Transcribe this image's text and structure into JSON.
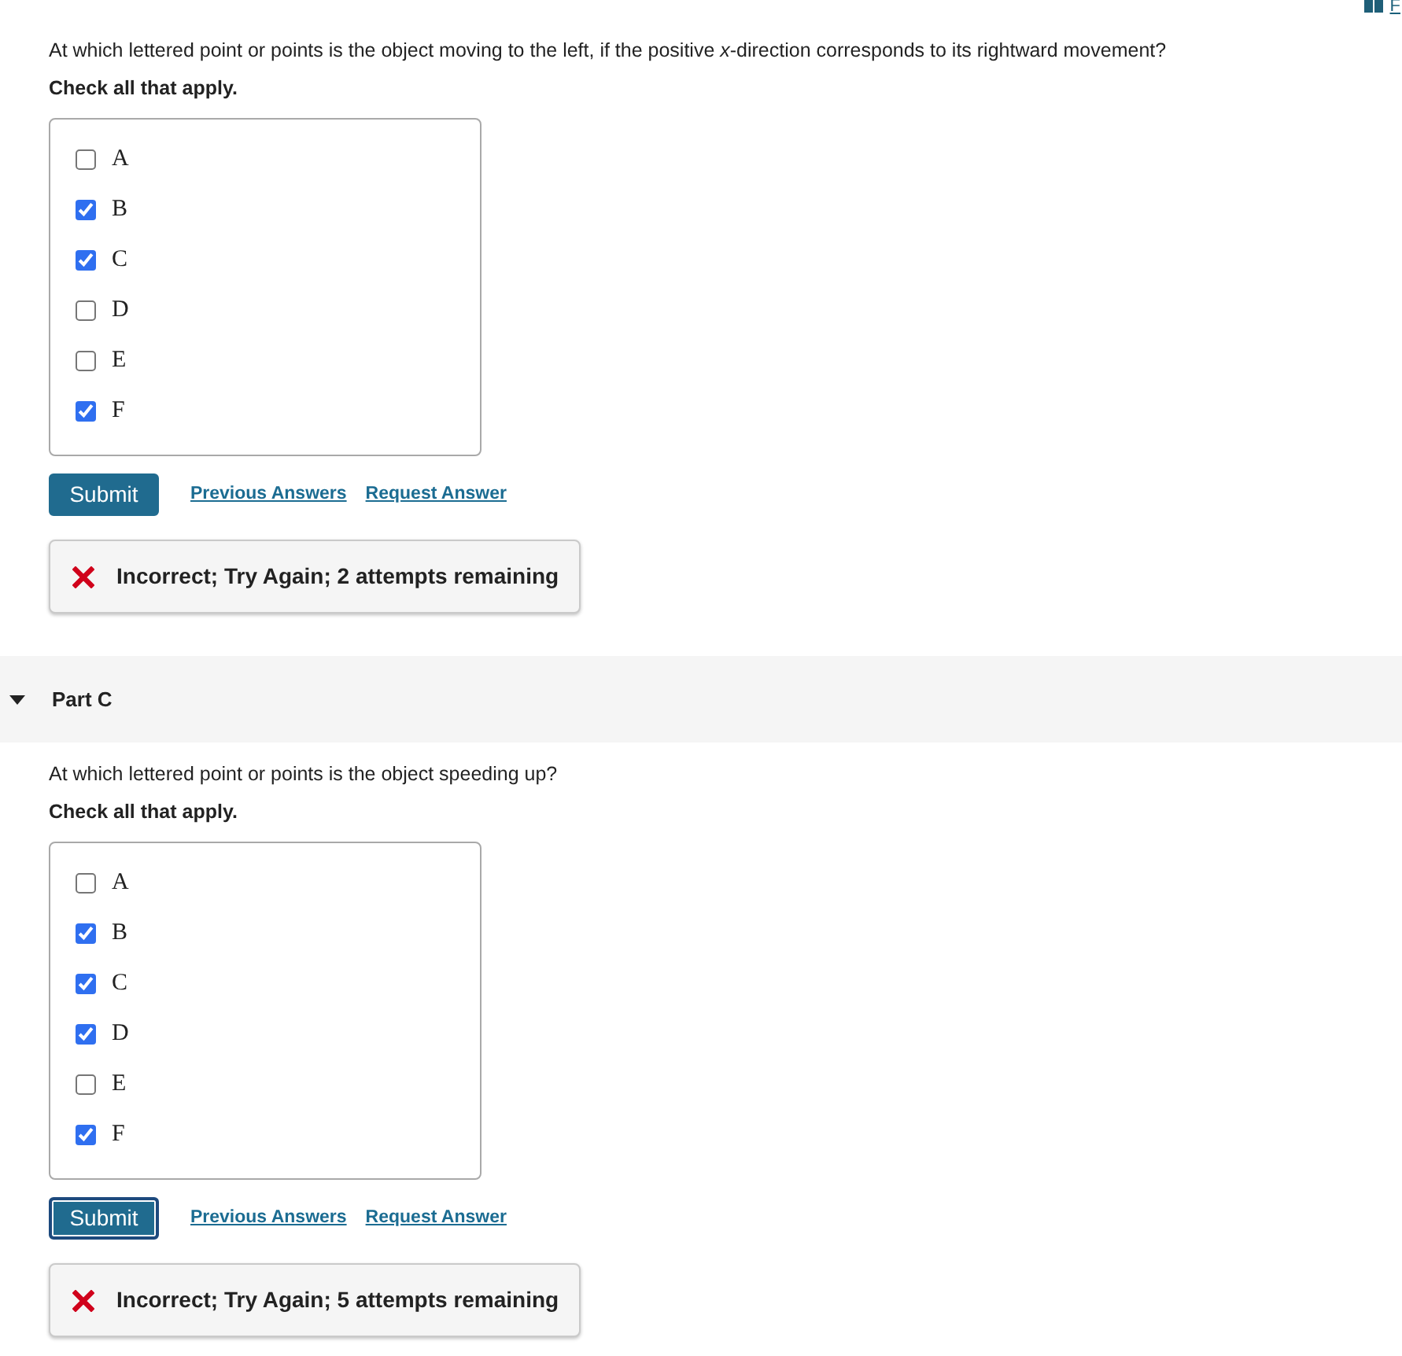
{
  "top_link": {
    "label": "F"
  },
  "questions": [
    {
      "prompt": "At which lettered point or points is the object moving to the left, if the positive *x*-direction corresponds to its rightward movement?",
      "instruction": "Check all that apply.",
      "options": [
        {
          "label": "A",
          "checked": false
        },
        {
          "label": "B",
          "checked": true
        },
        {
          "label": "C",
          "checked": true
        },
        {
          "label": "D",
          "checked": false
        },
        {
          "label": "E",
          "checked": false
        },
        {
          "label": "F",
          "checked": true
        }
      ],
      "submit": {
        "label": "Submit",
        "focused": false
      },
      "links": [
        "Previous Answers",
        "Request Answer"
      ],
      "feedback": {
        "kind": "incorrect",
        "text": "Incorrect; Try Again; 2 attempts remaining"
      }
    },
    {
      "part_header": {
        "title": "Part C",
        "expanded": true
      },
      "prompt": "At which lettered point or points is the object speeding up?",
      "instruction": "Check all that apply.",
      "options": [
        {
          "label": "A",
          "checked": false
        },
        {
          "label": "B",
          "checked": true
        },
        {
          "label": "C",
          "checked": true
        },
        {
          "label": "D",
          "checked": true
        },
        {
          "label": "E",
          "checked": false
        },
        {
          "label": "F",
          "checked": true
        }
      ],
      "submit": {
        "label": "Submit",
        "focused": true
      },
      "links": [
        "Previous Answers",
        "Request Answer"
      ],
      "feedback": {
        "kind": "incorrect",
        "text": "Incorrect; Try Again; 5 attempts remaining"
      }
    }
  ]
}
